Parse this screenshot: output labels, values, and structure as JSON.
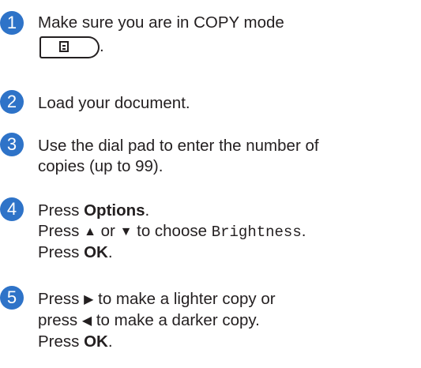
{
  "steps": [
    {
      "number": "1",
      "line1": "Make sure you are in COPY mode",
      "line2_suffix": "."
    },
    {
      "number": "2",
      "line1": "Load your document."
    },
    {
      "number": "3",
      "line1": "Use the dial pad to enter the number of",
      "line2": "copies (up to 99)."
    },
    {
      "number": "4",
      "l1_pre": "Press ",
      "l1_bold": "Options",
      "l1_post": ".",
      "l2_pre": "Press ",
      "l2_up": "▲",
      "l2_mid": " or ",
      "l2_down": "▼",
      "l2_post": " to choose ",
      "l2_mono": "Brightness",
      "l2_end": ".",
      "l3_pre": "Press ",
      "l3_bold": "OK",
      "l3_post": "."
    },
    {
      "number": "5",
      "l1_pre": "Press ",
      "l1_glyph": "▶",
      "l1_post": " to make a lighter copy or",
      "l2_pre": "press ",
      "l2_glyph": "◀",
      "l2_post": " to make a darker copy.",
      "l3_pre": "Press ",
      "l3_bold": "OK",
      "l3_post": "."
    }
  ],
  "icons": {
    "copy_key": "copy-mode-key-icon"
  },
  "colors": {
    "step_badge": "#2e73c8",
    "text": "#231f20"
  }
}
